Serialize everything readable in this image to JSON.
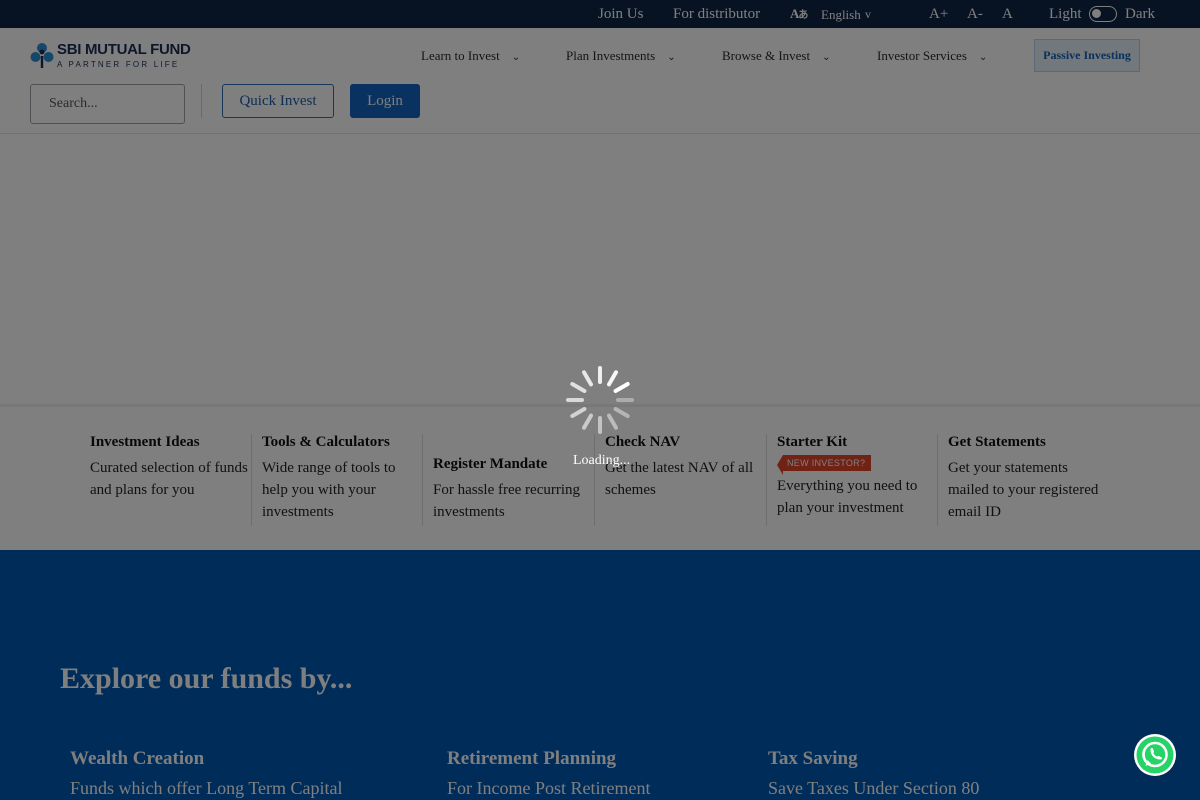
{
  "topbar": {
    "join_us": "Join Us",
    "for_distributor": "For distributor",
    "language": "English",
    "language_icon": "translate-icon",
    "font_increase": "A+",
    "font_decrease": "A-",
    "font_reset": "A",
    "theme_light": "Light",
    "theme_dark": "Dark"
  },
  "brand": {
    "name": "SBI MUTUAL FUND",
    "tagline": "A PARTNER FOR LIFE",
    "logo_icon": "sbi-logo-icon"
  },
  "nav": {
    "items": [
      {
        "label": "Learn to Invest"
      },
      {
        "label": "Plan Investments"
      },
      {
        "label": "Browse & Invest"
      },
      {
        "label": "Investor Services"
      }
    ],
    "passive_investing": "Passive Investing"
  },
  "search": {
    "placeholder": "Search..."
  },
  "actions": {
    "quick_invest": "Quick Invest",
    "login": "Login"
  },
  "cards": [
    {
      "title": "Investment Ideas",
      "desc": "Curated selection of funds and plans for you"
    },
    {
      "title": "Tools & Calculators",
      "desc": "Wide range of tools to help you with your investments"
    },
    {
      "title": "Register Mandate",
      "desc": "For hassle free recurring investments"
    },
    {
      "title": "Check NAV",
      "desc": "Get the latest NAV of all schemes"
    },
    {
      "title": "Starter Kit",
      "badge": "NEW INVESTOR?",
      "desc": "Everything you need to plan your investment"
    },
    {
      "title": "Get Statements",
      "desc": "Get your statements mailed to your registered email ID"
    }
  ],
  "explore": {
    "title": "Explore our funds by...",
    "categories": [
      {
        "title": "Wealth Creation",
        "subtitle": "Funds which offer Long Term Capital"
      },
      {
        "title": "Retirement Planning",
        "subtitle": "For Income Post Retirement"
      },
      {
        "title": "Tax Saving",
        "subtitle": "Save Taxes Under Section 80"
      }
    ]
  },
  "overlay": {
    "loading_text": "Loading..."
  },
  "colors": {
    "topbar_bg": "#0f2747",
    "primary": "#1265c2",
    "explore_bg": "#0059b2",
    "badge": "#e0442a",
    "whatsapp": "#25d366"
  },
  "icons": {
    "spinner": "loading-spinner-icon",
    "whatsapp": "whatsapp-icon",
    "chevron": "chevron-down-icon"
  }
}
